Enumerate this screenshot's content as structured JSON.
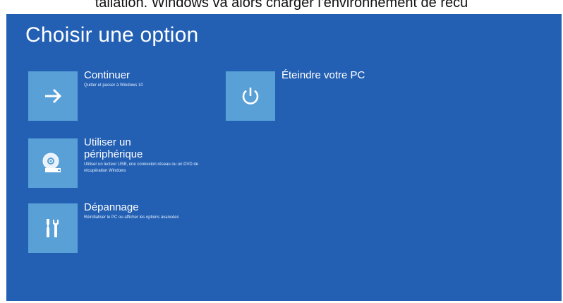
{
  "page": {
    "caption": "tallation. Windows va alors charger l'environnement de récu"
  },
  "screen": {
    "title": "Choisir une option",
    "options": [
      {
        "label": "Continuer",
        "description": "Quitter et passer à Windows 10",
        "icon": "arrow-right-icon"
      },
      {
        "label": "Utiliser un périphérique",
        "description": "Utiliser un lecteur USB, une connexion réseau ou un DVD de récupération Windows",
        "icon": "disc-drive-icon"
      },
      {
        "label": "Dépannage",
        "description": "Réinitialiser le PC ou afficher les options avancées",
        "icon": "tools-icon"
      },
      {
        "label": "Éteindre votre PC",
        "description": "",
        "icon": "power-icon"
      }
    ]
  },
  "colors": {
    "background": "#2360b4",
    "tile": "#58a0d6",
    "text": "#ffffff"
  }
}
